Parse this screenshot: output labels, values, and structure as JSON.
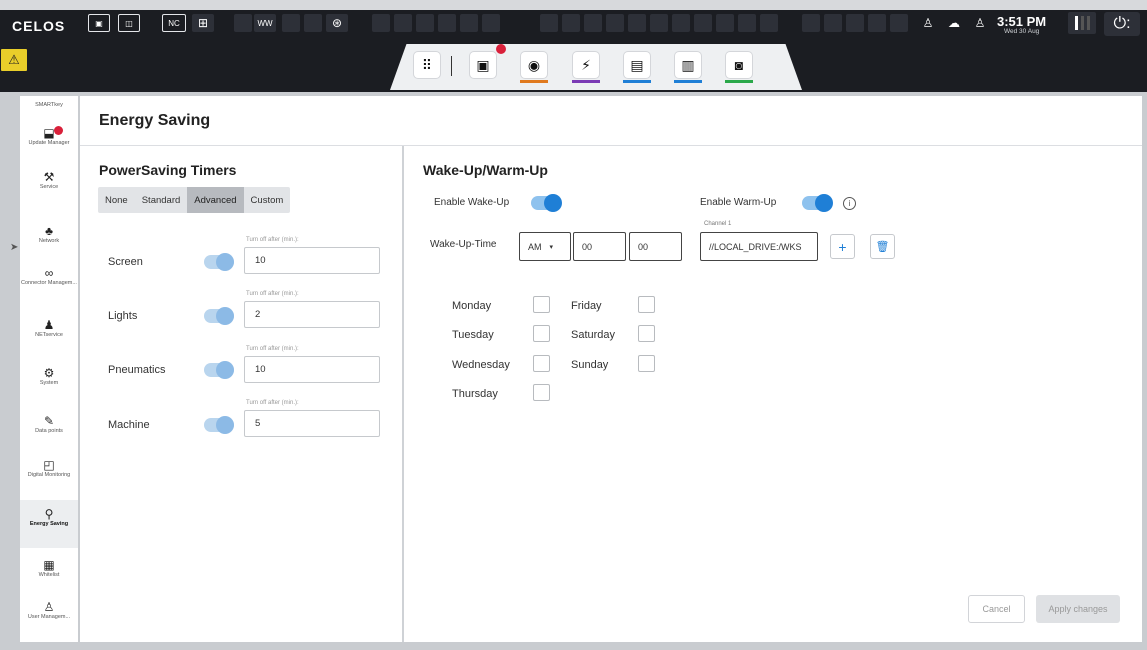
{
  "topbar": {
    "brand": "CELOS",
    "nc_label": "NC",
    "wave_label": "WW",
    "time": "3:51 PM",
    "date": "Wed 30 Aug",
    "power_symbol": "⏻:",
    "warning_symbol": "⚠"
  },
  "dock": {
    "items": [
      {
        "icon": "apps-grid-icon",
        "glyph": "⠿",
        "accent": ""
      },
      {
        "icon": "machine-icon",
        "glyph": "▣",
        "accent": ""
      },
      {
        "icon": "shield-icon",
        "glyph": "◉",
        "accent": "#e07a1f"
      },
      {
        "icon": "energy-icon",
        "glyph": "⚡",
        "accent": "#7b3bb5"
      },
      {
        "icon": "data-icon",
        "glyph": "▤",
        "accent": "#1f7fd6"
      },
      {
        "icon": "document-icon",
        "glyph": "▥",
        "accent": "#1f7fd6"
      },
      {
        "icon": "camera-icon",
        "glyph": "◙",
        "accent": "#2aa84a"
      }
    ]
  },
  "sidebar": {
    "header": "SMARTkey",
    "items": [
      {
        "label": "Update Manager",
        "icon": "update-icon",
        "glyph": "⬓"
      },
      {
        "label": "Service",
        "icon": "service-icon",
        "glyph": "⚒"
      },
      {
        "label": "Network",
        "icon": "network-icon",
        "glyph": "♣"
      },
      {
        "label": "Connector Managem...",
        "icon": "connector-icon",
        "glyph": "∞"
      },
      {
        "label": "NETservice",
        "icon": "netservice-icon",
        "glyph": "♟"
      },
      {
        "label": "System",
        "icon": "system-icon",
        "glyph": "⚙"
      },
      {
        "label": "Data points",
        "icon": "pencil-icon",
        "glyph": "✎"
      },
      {
        "label": "Digital Monitoring",
        "icon": "monitoring-icon",
        "glyph": "◰"
      },
      {
        "label": "Energy Saving",
        "icon": "energy-saving-icon",
        "glyph": "⚲"
      },
      {
        "label": "Whitelist",
        "icon": "whitelist-icon",
        "glyph": "▦"
      },
      {
        "label": "User Managem...",
        "icon": "user-icon",
        "glyph": "♙"
      }
    ]
  },
  "page": {
    "title": "Energy Saving"
  },
  "timers": {
    "title": "PowerSaving Timers",
    "modes": [
      "None",
      "Standard",
      "Advanced",
      "Custom"
    ],
    "selected_mode": "Advanced",
    "hint": "Turn off after (min.):",
    "rows": [
      {
        "label": "Screen",
        "value": "10"
      },
      {
        "label": "Lights",
        "value": "2"
      },
      {
        "label": "Pneumatics",
        "value": "10"
      },
      {
        "label": "Machine",
        "value": "5"
      }
    ]
  },
  "wake": {
    "title": "Wake-Up/Warm-Up",
    "enable_wake_label": "Enable Wake-Up",
    "enable_warm_label": "Enable Warm-Up",
    "time_label": "Wake-Up-Time",
    "ampm": "AM",
    "hour": "00",
    "minute": "00",
    "channel_label": "Channel 1",
    "channel_value": "//LOCAL_DRIVE:/WKS",
    "add_symbol": "+",
    "delete_symbol": "🗑",
    "info_symbol": "i",
    "days_left": [
      "Monday",
      "Tuesday",
      "Wednesday",
      "Thursday"
    ],
    "days_right": [
      "Friday",
      "Saturday",
      "Sunday"
    ]
  },
  "actions": {
    "cancel": "Cancel",
    "apply": "Apply changes"
  }
}
